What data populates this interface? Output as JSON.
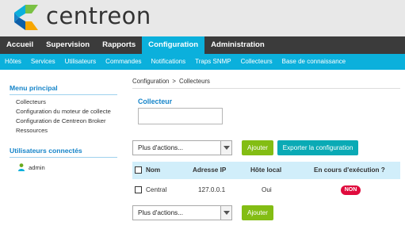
{
  "brand": {
    "name": "centreon",
    "colors": {
      "primary": "#0bb0dc",
      "dark": "#3b3b3b",
      "green": "#83bd14",
      "teal": "#0aaab5",
      "red": "#e00b3d"
    }
  },
  "main_nav": [
    {
      "label": "Accueil"
    },
    {
      "label": "Supervision"
    },
    {
      "label": "Rapports"
    },
    {
      "label": "Configuration",
      "active": true
    },
    {
      "label": "Administration"
    }
  ],
  "sub_nav": [
    {
      "label": "Hôtes"
    },
    {
      "label": "Services"
    },
    {
      "label": "Utilisateurs"
    },
    {
      "label": "Commandes"
    },
    {
      "label": "Notifications"
    },
    {
      "label": "Traps SNMP"
    },
    {
      "label": "Collecteurs"
    },
    {
      "label": "Base de connaissance"
    }
  ],
  "sidebar": {
    "menu_title": "Menu principal",
    "menu_items": [
      {
        "label": "Collecteurs"
      },
      {
        "label": "Configuration du moteur de collecte"
      },
      {
        "label": "Configuration de Centreon Broker"
      },
      {
        "label": "Ressources"
      }
    ],
    "users_title": "Utilisateurs connectés",
    "users": [
      {
        "name": "admin",
        "icon": "user-icon"
      }
    ]
  },
  "breadcrumb": {
    "parent": "Configuration",
    "separator": ">",
    "current": "Collecteurs"
  },
  "filter": {
    "label": "Collecteur",
    "value": ""
  },
  "actions": {
    "select_value": "Plus d'actions...",
    "add_button": "Ajouter",
    "export_button": "Exporter la configuration"
  },
  "table": {
    "headers": {
      "name": "Nom",
      "ip": "Adresse IP",
      "local": "Hôte local",
      "running": "En cours d'exécution ?"
    },
    "rows": [
      {
        "name": "Central",
        "ip": "127.0.0.1",
        "local": "Oui",
        "running": "NON"
      }
    ]
  }
}
